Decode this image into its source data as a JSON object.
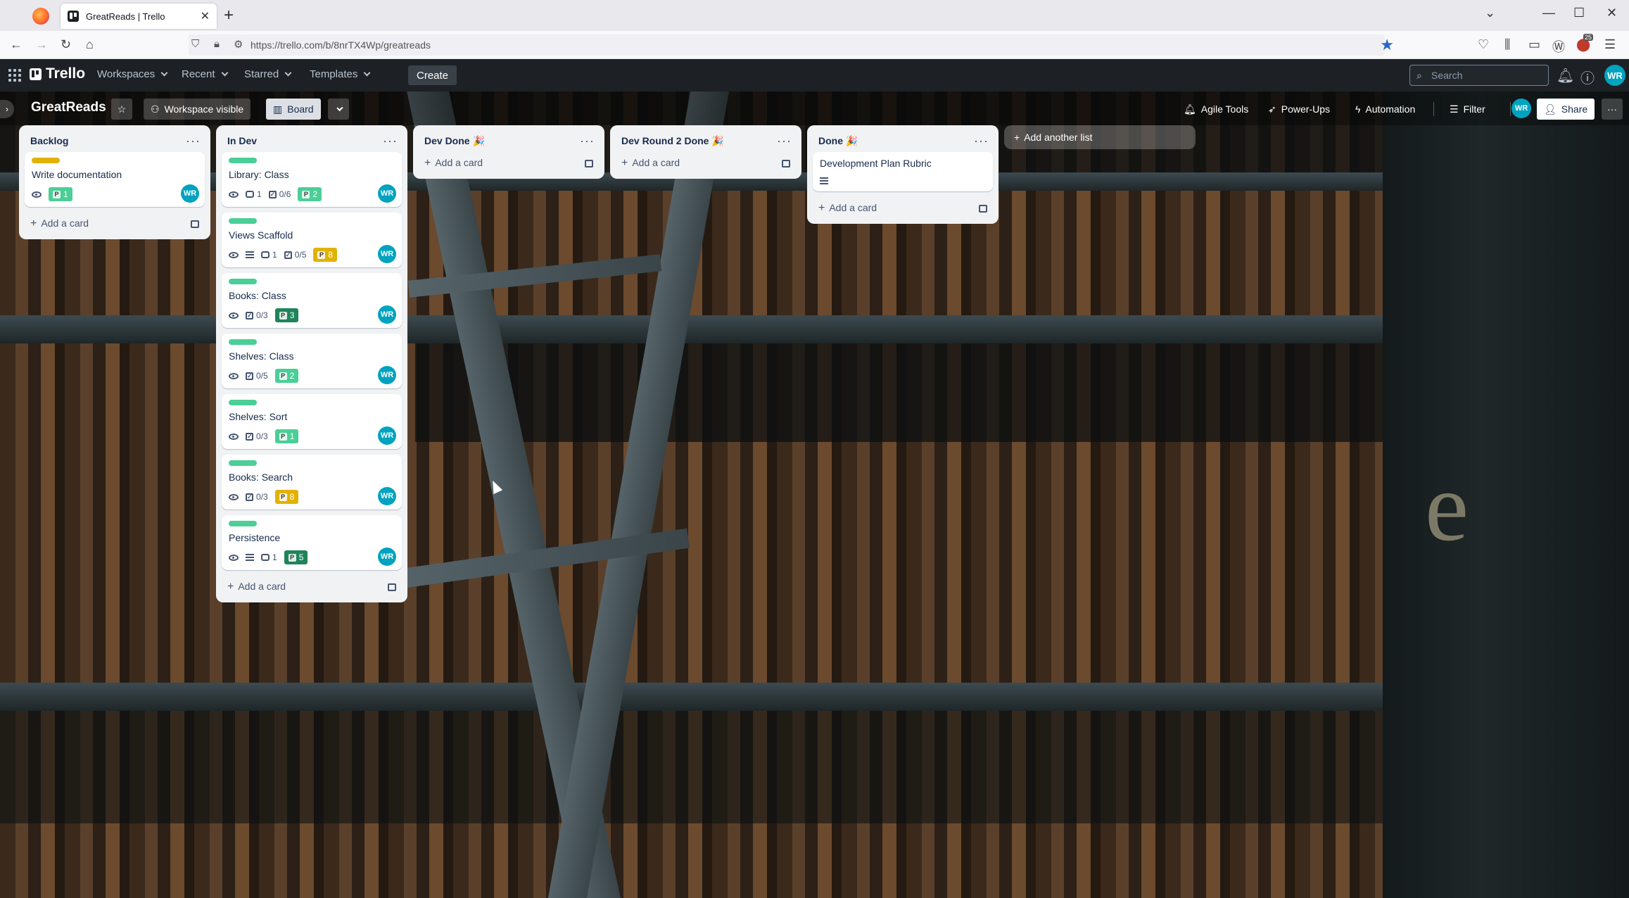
{
  "browser": {
    "tab_title": "GreatReads | Trello",
    "new_tab": "+",
    "url": "https://trello.com/b/8nrTX4Wp/greatreads",
    "ext_badge": "25"
  },
  "header": {
    "logo": "Trello",
    "menus": [
      "Workspaces",
      "Recent",
      "Starred",
      "Templates"
    ],
    "create_label": "Create",
    "search_placeholder": "Search",
    "avatar_initials": "WR"
  },
  "board": {
    "name": "GreatReads",
    "visibility": "Workspace visible",
    "view": "Board",
    "right_buttons": [
      "Agile Tools",
      "Power-Ups",
      "Automation",
      "Filter"
    ],
    "share": "Share",
    "add_list": "Add another list"
  },
  "lists": [
    {
      "title": "Backlog",
      "cards": [
        {
          "label": "yellow",
          "title": "Write documentation",
          "points": "1",
          "points_color": "teal",
          "member": "WR"
        }
      ],
      "add": "Add a card"
    },
    {
      "title": "In Dev",
      "cards": [
        {
          "label": "green",
          "title": "Library: Class",
          "comments": "1",
          "checklist": "0/6",
          "points": "2",
          "points_color": "teal",
          "member": "WR"
        },
        {
          "label": "green",
          "title": "Views Scaffold",
          "comments": "1",
          "checklist": "0/5",
          "points": "8",
          "points_color": "yellow",
          "member": "WR",
          "description": true
        },
        {
          "label": "green",
          "title": "Books: Class",
          "checklist": "0/3",
          "points": "3",
          "points_color": "green",
          "member": "WR"
        },
        {
          "label": "green",
          "title": "Shelves: Class",
          "checklist": "0/5",
          "points": "2",
          "points_color": "teal",
          "member": "WR"
        },
        {
          "label": "green",
          "title": "Shelves: Sort",
          "checklist": "0/3",
          "points": "1",
          "points_color": "teal",
          "member": "WR"
        },
        {
          "label": "green",
          "title": "Books: Search",
          "checklist": "0/3",
          "points": "8",
          "points_color": "yellow",
          "member": "WR"
        },
        {
          "label": "green",
          "title": "Persistence",
          "comments": "1",
          "points": "5",
          "points_color": "green",
          "member": "WR",
          "description": true
        }
      ],
      "add": "Add a card"
    },
    {
      "title": "Dev Done 🎉",
      "cards": [],
      "add": "Add a card"
    },
    {
      "title": "Dev Round 2 Done 🎉",
      "cards": [],
      "add": "Add a card"
    },
    {
      "title": "Done 🎉",
      "cards": [
        {
          "title": "Development Plan Rubric",
          "description": true
        }
      ],
      "add": "Add a card"
    }
  ],
  "background_text": "e"
}
